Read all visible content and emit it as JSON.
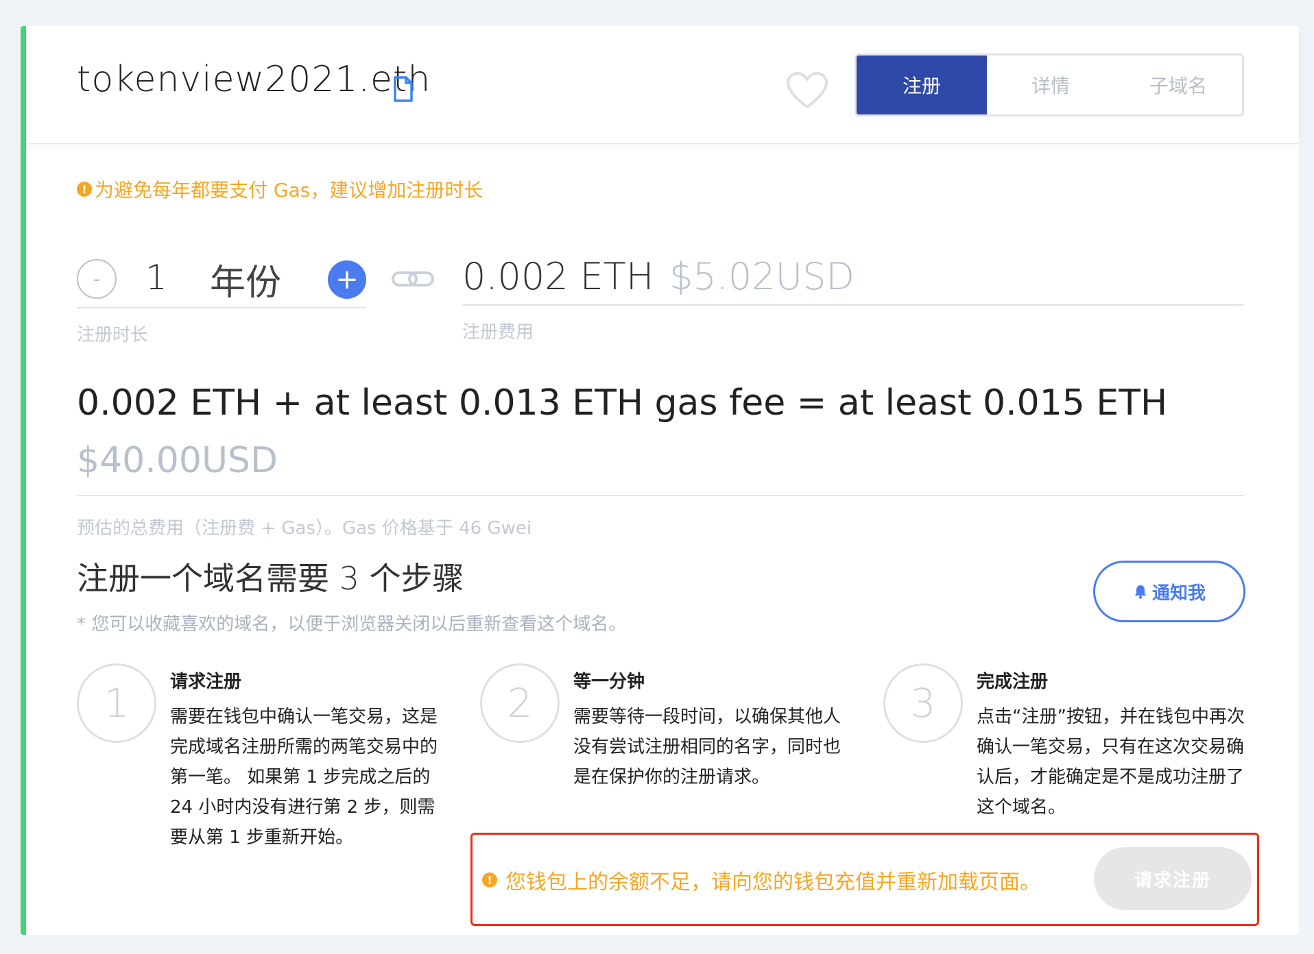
{
  "header": {
    "domain": "tokenview2021.eth",
    "tabs": [
      {
        "label": "注册",
        "active": true
      },
      {
        "label": "详情",
        "active": false
      },
      {
        "label": "子域名",
        "active": false
      }
    ]
  },
  "registration": {
    "gas_warning": "为避免每年都要支付 Gas，建议增加注册时长",
    "years": "1",
    "years_unit": "年份",
    "minus_label": "-",
    "plus_label": "+",
    "duration_label": "注册时长",
    "price_eth": "0.002 ETH",
    "price_usd": "$5.02USD",
    "price_label": "注册费用",
    "total_formula": "0.002 ETH + at least 0.013 ETH gas fee = at least 0.015 ETH",
    "total_usd": "$40.00USD",
    "estimate_note": "预估的总费用（注册费 + Gas）。Gas 价格基于 46 Gwei"
  },
  "steps": {
    "title": "注册一个域名需要 3 个步骤",
    "note": "* 您可以收藏喜欢的域名，以便于浏览器关闭以后重新查看这个域名。",
    "notify_label": "通知我",
    "items": [
      {
        "number": "1",
        "title": "请求注册",
        "text": "需要在钱包中确认一笔交易，这是完成域名注册所需的两笔交易中的第一笔。 如果第 1 步完成之后的 24 小时内没有进行第 2 步，则需要从第 1 步重新开始。"
      },
      {
        "number": "2",
        "title": "等一分钟",
        "text": "需要等待一段时间，以确保其他人没有尝试注册相同的名字，同时也是在保护你的注册请求。"
      },
      {
        "number": "3",
        "title": "完成注册",
        "text": "点击“注册”按钮，并在钱包中再次确认一笔交易，只有在这次交易确认后，才能确定是不是成功注册了这个域名。"
      }
    ]
  },
  "footer": {
    "balance_warning": "您钱包上的余额不足，请向您的钱包充值并重新加载页面。",
    "request_button": "请求注册"
  },
  "colors": {
    "accent_blue": "#2f49a8",
    "link_blue": "#4a7cf0",
    "warning_orange": "#f5a623",
    "success_green": "#42d674",
    "highlight_red": "#ec2d1c"
  }
}
